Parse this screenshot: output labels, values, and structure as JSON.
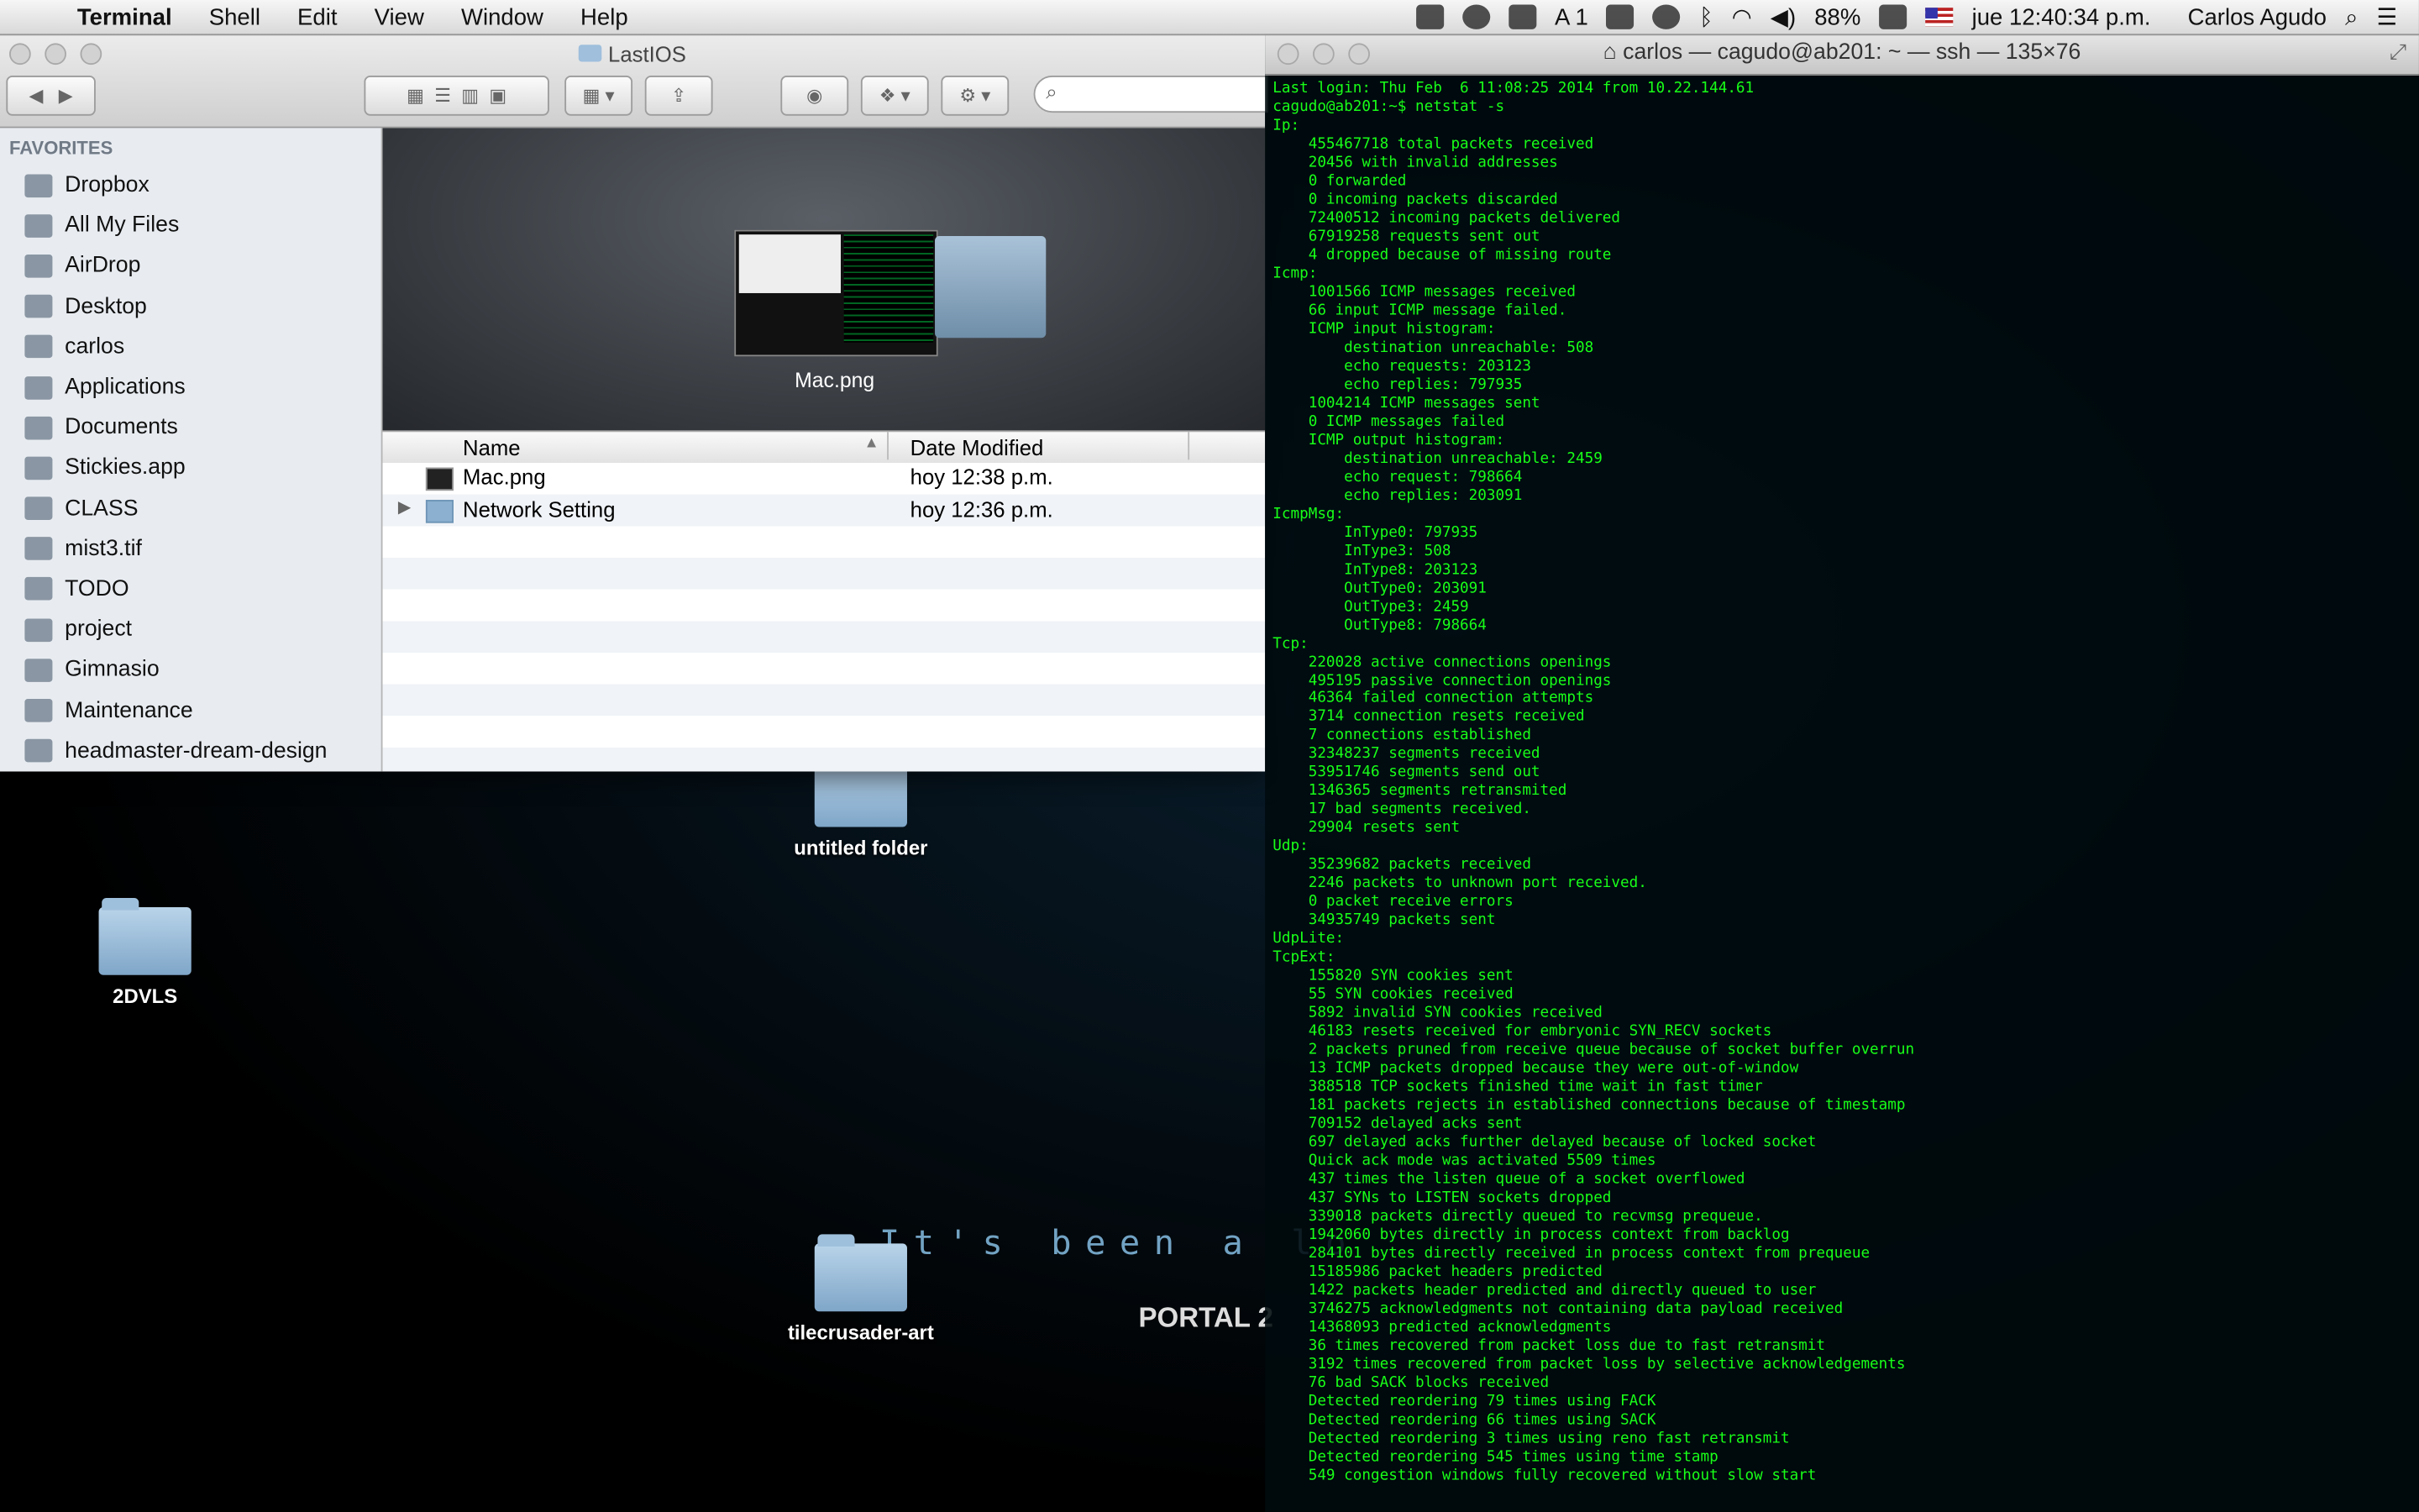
{
  "menubar": {
    "app": "Terminal",
    "items": [
      "Shell",
      "Edit",
      "View",
      "Window",
      "Help"
    ],
    "status": {
      "input_count": "1",
      "battery": "88%",
      "clock": "jue 12:40:34 p.m.",
      "user": "Carlos Agudo"
    }
  },
  "desktop": {
    "icons": [
      {
        "label": "untitled folder"
      },
      {
        "label": "2DVLS"
      },
      {
        "label": "tilecrusader-art"
      }
    ],
    "wallpaper_text": "It's been a lo",
    "wallpaper_logo": "PORTAL 2"
  },
  "finder": {
    "title": "LastIOS",
    "sidebar_header": "FAVORITES",
    "sidebar": [
      "Dropbox",
      "All My Files",
      "AirDrop",
      "Desktop",
      "carlos",
      "Applications",
      "Documents",
      "Stickies.app",
      "CLASS",
      "mist3.tif",
      "TODO",
      "project",
      "Gimnasio",
      "Maintenance",
      "headmaster-dream-design"
    ],
    "preview_name": "Mac.png",
    "columns": {
      "name": "Name",
      "date": "Date Modified"
    },
    "files": [
      {
        "name": "Mac.png",
        "date": "hoy 12:38 p.m."
      },
      {
        "name": "Network Setting",
        "date": "hoy 12:36 p.m."
      }
    ]
  },
  "terminal": {
    "title": "carlos — cagudo@ab201: ~ — ssh — 135×76",
    "output": "Last login: Thu Feb  6 11:08:25 2014 from 10.22.144.61\ncagudo@ab201:~$ netstat -s\nIp:\n    455467718 total packets received\n    20456 with invalid addresses\n    0 forwarded\n    0 incoming packets discarded\n    72400512 incoming packets delivered\n    67919258 requests sent out\n    4 dropped because of missing route\nIcmp:\n    1001566 ICMP messages received\n    66 input ICMP message failed.\n    ICMP input histogram:\n        destination unreachable: 508\n        echo requests: 203123\n        echo replies: 797935\n    1004214 ICMP messages sent\n    0 ICMP messages failed\n    ICMP output histogram:\n        destination unreachable: 2459\n        echo request: 798664\n        echo replies: 203091\nIcmpMsg:\n        InType0: 797935\n        InType3: 508\n        InType8: 203123\n        OutType0: 203091\n        OutType3: 2459\n        OutType8: 798664\nTcp:\n    220028 active connections openings\n    495195 passive connection openings\n    46364 failed connection attempts\n    3714 connection resets received\n    7 connections established\n    32348237 segments received\n    53951746 segments send out\n    1346365 segments retransmited\n    17 bad segments received.\n    29904 resets sent\nUdp:\n    35239682 packets received\n    2246 packets to unknown port received.\n    0 packet receive errors\n    34935749 packets sent\nUdpLite:\nTcpExt:\n    155820 SYN cookies sent\n    55 SYN cookies received\n    5892 invalid SYN cookies received\n    46183 resets received for embryonic SYN_RECV sockets\n    2 packets pruned from receive queue because of socket buffer overrun\n    13 ICMP packets dropped because they were out-of-window\n    388518 TCP sockets finished time wait in fast timer\n    181 packets rejects in established connections because of timestamp\n    709152 delayed acks sent\n    697 delayed acks further delayed because of locked socket\n    Quick ack mode was activated 5509 times\n    437 times the listen queue of a socket overflowed\n    437 SYNs to LISTEN sockets dropped\n    339018 packets directly queued to recvmsg prequeue.\n    1942060 bytes directly in process context from backlog\n    284101 bytes directly received in process context from prequeue\n    15185986 packet headers predicted\n    1422 packets header predicted and directly queued to user\n    3746275 acknowledgments not containing data payload received\n    14368093 predicted acknowledgments\n    36 times recovered from packet loss due to fast retransmit\n    3192 times recovered from packet loss by selective acknowledgements\n    76 bad SACK blocks received\n    Detected reordering 79 times using FACK\n    Detected reordering 66 times using SACK\n    Detected reordering 3 times using reno fast retransmit\n    Detected reordering 545 times using time stamp\n    549 congestion windows fully recovered without slow start"
  },
  "colors": {
    "terminal_text": "#18ff18",
    "desktop_bg": "#000000"
  }
}
